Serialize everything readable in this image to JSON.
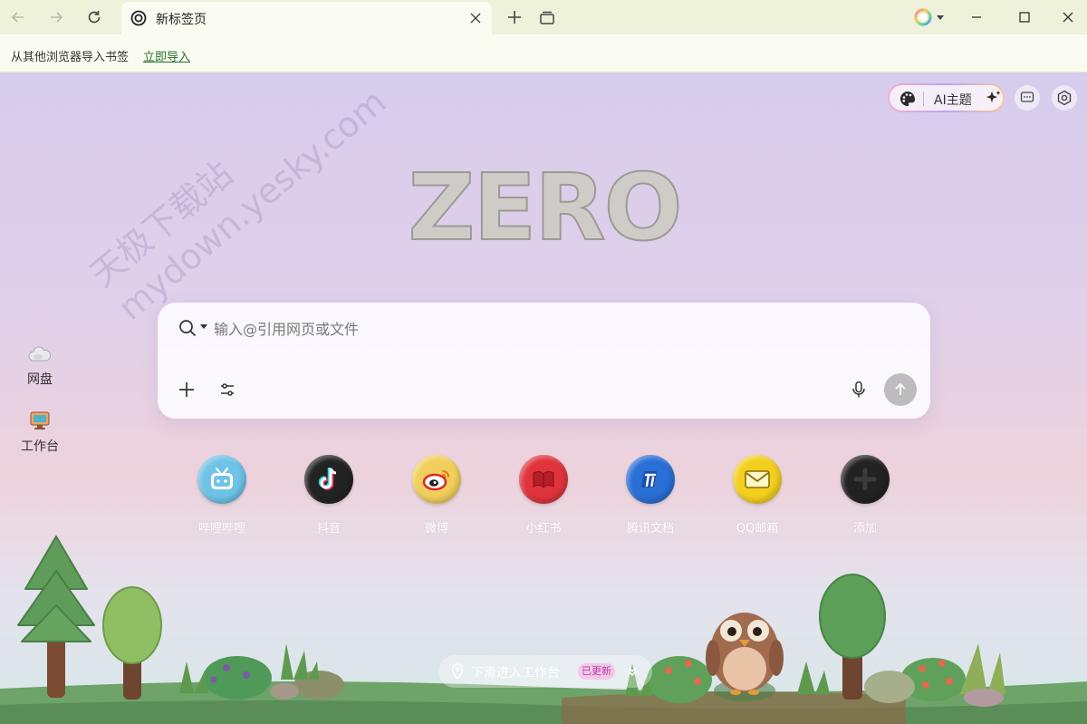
{
  "browser": {
    "tab_title": "新标签页",
    "import_prompt": "从其他浏览器导入书签",
    "import_link": "立即导入"
  },
  "toolbar": {
    "theme_label": "AI主题"
  },
  "watermark": {
    "line1": "天极下载站",
    "line2": "mydown.yesky.com"
  },
  "logo": "ZERO",
  "sidebar": {
    "items": [
      {
        "label": "网盘",
        "icon": "cloud-icon"
      },
      {
        "label": "工作台",
        "icon": "monitor-icon"
      }
    ]
  },
  "search": {
    "placeholder": "输入@引用网页或文件"
  },
  "shortcuts": [
    {
      "label": "哔哩哔哩",
      "icon": "bilibili-icon",
      "color": "#6fc3e8"
    },
    {
      "label": "抖音",
      "icon": "douyin-icon",
      "color": "#232323"
    },
    {
      "label": "微博",
      "icon": "weibo-icon",
      "color": "#f2cf5c"
    },
    {
      "label": "小红书",
      "icon": "xiaohongshu-icon",
      "color": "#e0343c"
    },
    {
      "label": "腾讯文档",
      "icon": "tencent-docs-icon",
      "color": "#2a6fd6"
    },
    {
      "label": "QQ邮箱",
      "icon": "mail-icon",
      "color": "#f3cf1e"
    },
    {
      "label": "添加",
      "icon": "plus-icon",
      "color": "#222222"
    }
  ],
  "scroll_hint": {
    "text": "下滑进入工作台",
    "badge": "已更新"
  }
}
